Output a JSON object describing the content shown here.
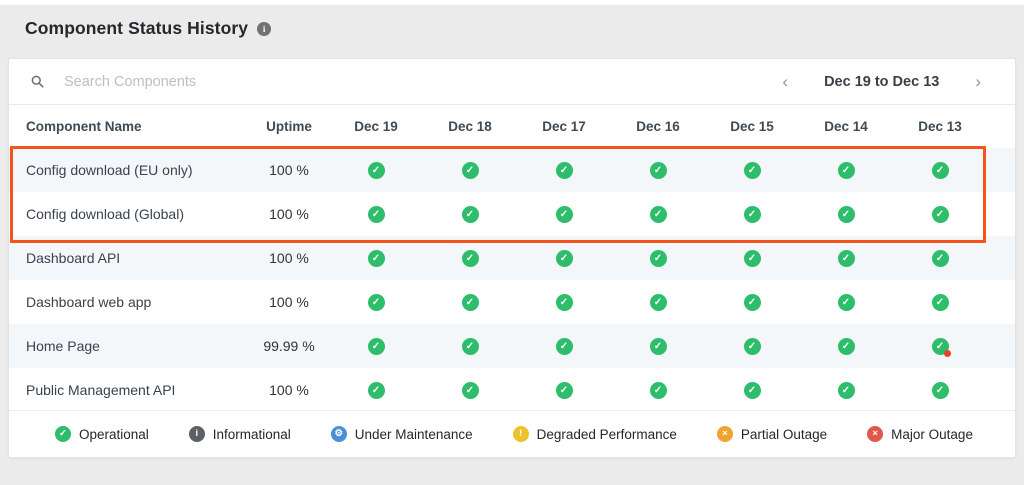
{
  "page": {
    "title": "Component Status History"
  },
  "toolbar": {
    "search_placeholder": "Search Components",
    "search_value": "",
    "prev_icon": "‹",
    "next_icon": "›",
    "date_range": "Dec 19 to Dec 13"
  },
  "table": {
    "columns": [
      "Component Name",
      "Uptime",
      "Dec 19",
      "Dec 18",
      "Dec 17",
      "Dec 16",
      "Dec 15",
      "Dec 14",
      "Dec 13"
    ],
    "rows": [
      {
        "name": "Config download (EU only)",
        "uptime": "100 %",
        "cells": [
          "operational",
          "operational",
          "operational",
          "operational",
          "operational",
          "operational",
          "operational"
        ]
      },
      {
        "name": "Config download (Global)",
        "uptime": "100 %",
        "cells": [
          "operational",
          "operational",
          "operational",
          "operational",
          "operational",
          "operational",
          "operational"
        ]
      },
      {
        "name": "Dashboard API",
        "uptime": "100 %",
        "cells": [
          "operational",
          "operational",
          "operational",
          "operational",
          "operational",
          "operational",
          "operational"
        ]
      },
      {
        "name": "Dashboard web app",
        "uptime": "100 %",
        "cells": [
          "operational",
          "operational",
          "operational",
          "operational",
          "operational",
          "operational",
          "operational"
        ]
      },
      {
        "name": "Home Page",
        "uptime": "99.99 %",
        "cells": [
          "operational",
          "operational",
          "operational",
          "operational",
          "operational",
          "operational",
          "operational_incident"
        ]
      },
      {
        "name": "Public Management API",
        "uptime": "100 %",
        "cells": [
          "operational",
          "operational",
          "operational",
          "operational",
          "operational",
          "operational",
          "operational"
        ]
      }
    ]
  },
  "status_icons": {
    "operational": {
      "icon": "check-circle-icon",
      "glyph": "✓",
      "color": "#2ebd6b"
    },
    "operational_incident": {
      "icon": "check-circle-icon",
      "glyph": "✓",
      "color": "#2ebd6b",
      "badge": "incident-dot",
      "badge_color": "#e8432d"
    }
  },
  "annotation": {
    "type": "highlight-box",
    "border_color": "#f3541e",
    "rows_highlighted": [
      "Config download (EU only)",
      "Config download (Global)"
    ]
  },
  "legend": [
    {
      "label": "Operational",
      "icon": "check-circle-icon",
      "glyph": "✓",
      "color": "#2ebd6b"
    },
    {
      "label": "Informational",
      "icon": "info-circle-icon",
      "glyph": "i",
      "color": "#5c6166"
    },
    {
      "label": "Under Maintenance",
      "icon": "wrench-circle-icon",
      "glyph": "⚙",
      "color": "#4a90d9"
    },
    {
      "label": "Degraded Performance",
      "icon": "exclamation-circle-icon",
      "glyph": "!",
      "color": "#edc22f"
    },
    {
      "label": "Partial Outage",
      "icon": "x-circle-icon",
      "glyph": "×",
      "color": "#f0a331"
    },
    {
      "label": "Major Outage",
      "icon": "x-circle-icon",
      "glyph": "×",
      "color": "#e2574c"
    }
  ],
  "title_info_icon": {
    "glyph": "i",
    "color": "#717171"
  }
}
